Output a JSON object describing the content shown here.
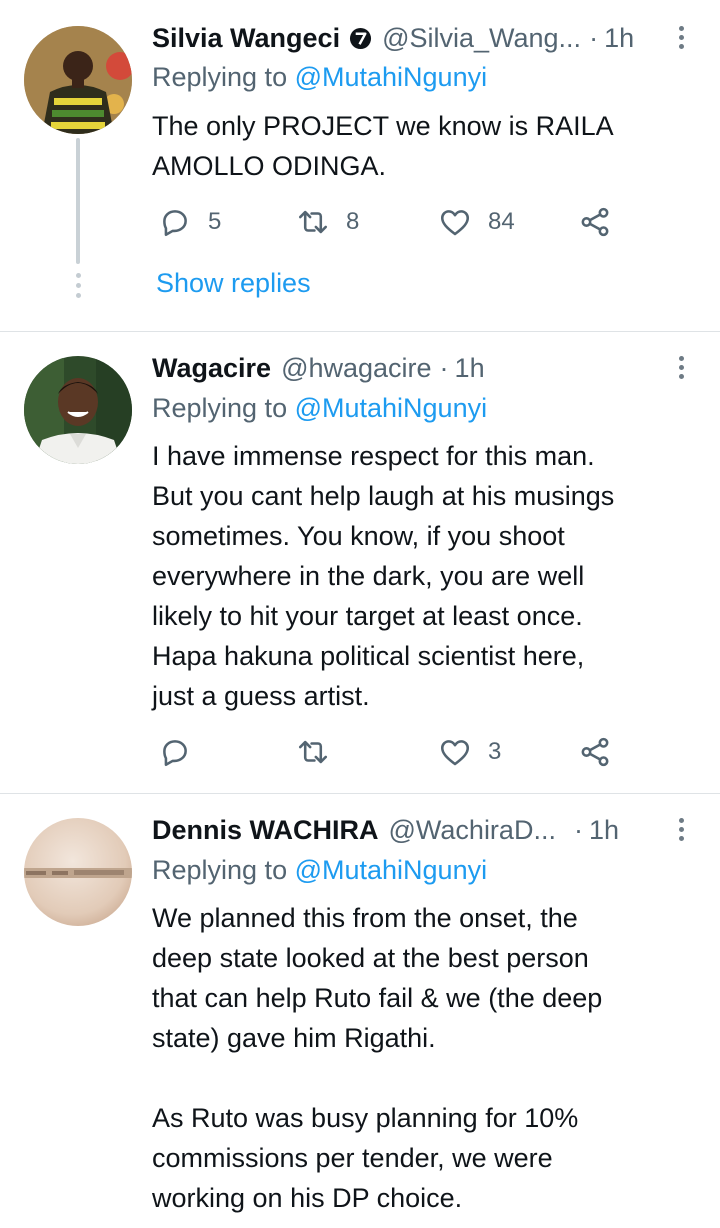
{
  "tweets": [
    {
      "name": "Silvia Wangeci",
      "verified": true,
      "handle": "@Silvia_Wang...",
      "separator": "·",
      "time": "1h",
      "replying_prefix": "Replying to ",
      "replying_to": "@MutahiNgunyi",
      "text": "The only PROJECT we know is RAILA\nAMOLLO ODINGA.",
      "replies": "5",
      "retweets": "8",
      "likes": "84",
      "show_replies": "Show replies"
    },
    {
      "name": "Wagacire",
      "handle": "@hwagacire",
      "separator": "·",
      "time": "1h",
      "replying_prefix": "Replying to ",
      "replying_to": "@MutahiNgunyi",
      "text": "I have immense respect for this man.\nBut you cant help laugh at his musings\nsometimes. You know, if you shoot\neverywhere in the dark, you are well\nlikely to hit your target at least once.\nHapa hakuna political scientist here,\njust a guess artist.",
      "replies": "",
      "retweets": "",
      "likes": "3"
    },
    {
      "name": "Dennis WACHIRA",
      "handle": "@WachiraD...",
      "separator": "·",
      "time": "1h",
      "replying_prefix": "Replying to ",
      "replying_to": "@MutahiNgunyi",
      "text": "We planned this from the onset, the\ndeep state looked at the best person\nthat can help Ruto fail & we (the deep\nstate) gave him Rigathi.\n\nAs Ruto was busy planning for 10%\ncommissions per tender, we were\nworking on his DP choice."
    }
  ],
  "icons": [
    "reply-icon",
    "retweet-icon",
    "like-icon",
    "share-icon",
    "verified-badge-icon",
    "more-options-icon"
  ],
  "colors": {
    "link": "#1d9bf0",
    "secondary_text": "#536471",
    "divider": "#dfe3e6",
    "text": "#0f1419"
  }
}
